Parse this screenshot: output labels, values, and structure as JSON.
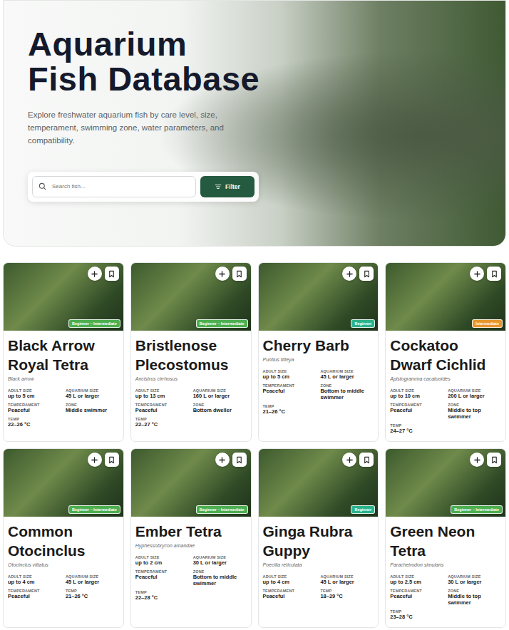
{
  "hero": {
    "title": "Aquarium Fish Database",
    "description": "Explore freshwater aquarium fish by care level, size, temperament, swimming zone, water parameters, and compatibility."
  },
  "search": {
    "placeholder": "Search fish...",
    "button": "Filter"
  },
  "fish": [
    {
      "name": "Black Arrow Royal Tetra",
      "scientific": "Black arrow",
      "care": "Beginner – Intermediate",
      "color": "#4caf50",
      "attributes": [
        {
          "label": "ADULT SIZE",
          "value": "up to 5 cm"
        },
        {
          "label": "AQUARIUM SIZE",
          "value": "45 L or larger"
        },
        {
          "label": "TEMPERAMENT",
          "value": "Peaceful"
        },
        {
          "label": "ZONE",
          "value": "Middle swimmer"
        },
        {
          "label": "TEMP",
          "value": "22–26 °C"
        }
      ]
    },
    {
      "name": "Bristlenose Plecostomus",
      "scientific": "Ancistrus cirrhosus",
      "care": "Beginner – Intermediate",
      "color": "#4caf50",
      "attributes": [
        {
          "label": "ADULT SIZE",
          "value": "up to 13 cm"
        },
        {
          "label": "AQUARIUM SIZE",
          "value": "160 L or larger"
        },
        {
          "label": "TEMPERAMENT",
          "value": "Peaceful"
        },
        {
          "label": "ZONE",
          "value": "Bottom dweller"
        },
        {
          "label": "TEMP",
          "value": "22–27 °C"
        }
      ]
    },
    {
      "name": "Cherry Barb",
      "scientific": "Puntius titteya",
      "care": "Beginner",
      "color": "#2bb38a",
      "attributes": [
        {
          "label": "ADULT SIZE",
          "value": "up to 5 cm"
        },
        {
          "label": "AQUARIUM SIZE",
          "value": "45 L or larger"
        },
        {
          "label": "TEMPERAMENT",
          "value": "Peaceful"
        },
        {
          "label": "ZONE",
          "value": "Bottom to middle swimmer"
        },
        {
          "label": "TEMP",
          "value": "21–26 °C"
        }
      ]
    },
    {
      "name": "Cockatoo Dwarf Cichlid",
      "scientific": "Apistogramma cacatuoides",
      "care": "Intermediate",
      "color": "#e8962e",
      "attributes": [
        {
          "label": "ADULT SIZE",
          "value": "up to 10 cm"
        },
        {
          "label": "AQUARIUM SIZE",
          "value": "200 L or larger"
        },
        {
          "label": "TEMPERAMENT",
          "value": "Peaceful"
        },
        {
          "label": "ZONE",
          "value": "Middle to top swimmer"
        },
        {
          "label": "TEMP",
          "value": "24–27 °C"
        }
      ]
    },
    {
      "name": "Common Otocinclus",
      "scientific": "Otocinclus vittatus",
      "care": "Beginner – Intermediate",
      "color": "#4caf50",
      "attributes": [
        {
          "label": "ADULT SIZE",
          "value": "up to 4 cm"
        },
        {
          "label": "AQUARIUM SIZE",
          "value": "45 L or larger"
        },
        {
          "label": "TEMPERAMENT",
          "value": "Peaceful"
        },
        {
          "label": "TEMP",
          "value": "21–26 °C"
        }
      ]
    },
    {
      "name": "Ember Tetra",
      "scientific": "Hyphessobrycon amandae",
      "care": "Beginner – Intermediate",
      "color": "#4caf50",
      "attributes": [
        {
          "label": "ADULT SIZE",
          "value": "up to 2 cm"
        },
        {
          "label": "AQUARIUM SIZE",
          "value": "30 L or larger"
        },
        {
          "label": "TEMPERAMENT",
          "value": "Peaceful"
        },
        {
          "label": "ZONE",
          "value": "Bottom to middle swimmer"
        },
        {
          "label": "TEMP",
          "value": "22–28 °C"
        }
      ]
    },
    {
      "name": "Ginga Rubra Guppy",
      "scientific": "Poecilia reticulata",
      "care": "Beginner",
      "color": "#2bb38a",
      "attributes": [
        {
          "label": "ADULT SIZE",
          "value": "up to 4 cm"
        },
        {
          "label": "AQUARIUM SIZE",
          "value": "45 L or larger"
        },
        {
          "label": "TEMPERAMENT",
          "value": "Peaceful"
        },
        {
          "label": "TEMP",
          "value": "18–29 °C"
        }
      ]
    },
    {
      "name": "Green Neon Tetra",
      "scientific": "Paracheirodon simulans",
      "care": "Beginner – Intermediate",
      "color": "#4caf50",
      "attributes": [
        {
          "label": "ADULT SIZE",
          "value": "up to 2.5 cm"
        },
        {
          "label": "AQUARIUM SIZE",
          "value": "30 L or larger"
        },
        {
          "label": "TEMPERAMENT",
          "value": "Peaceful"
        },
        {
          "label": "ZONE",
          "value": "Middle to top swimmer"
        },
        {
          "label": "TEMP",
          "value": "23–28 °C"
        }
      ]
    }
  ]
}
